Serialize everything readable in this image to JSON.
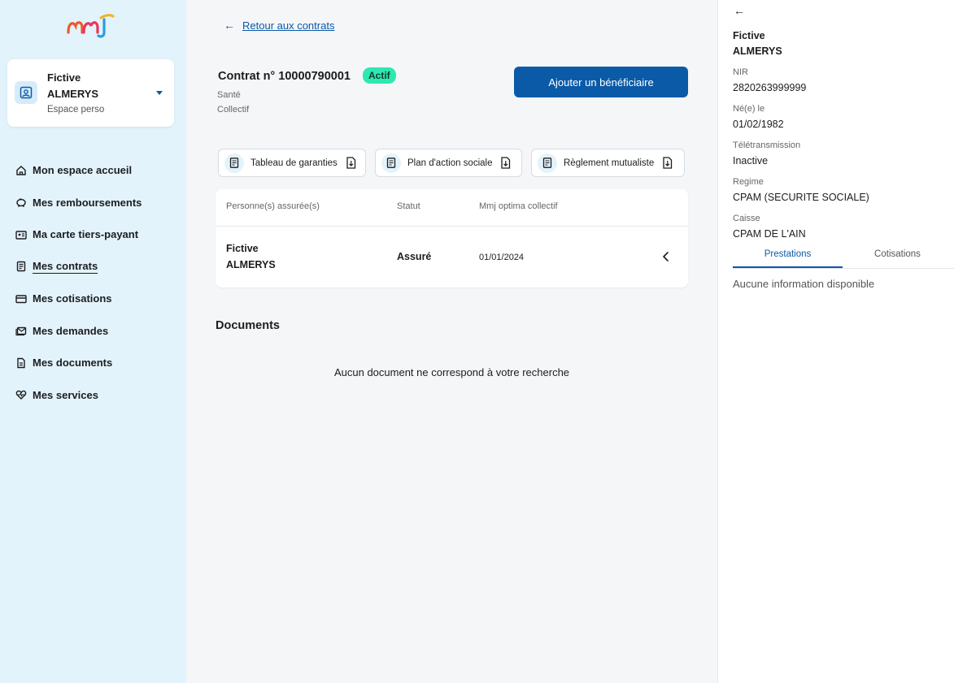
{
  "brand": {
    "logo_text": "mmj"
  },
  "profile": {
    "first_line": "Fictive",
    "second_line": "ALMERYS",
    "sub": "Espace perso"
  },
  "nav": {
    "items": [
      {
        "label": "Mon espace accueil",
        "icon": "home-icon"
      },
      {
        "label": "Mes remboursements",
        "icon": "piggy-bank-icon"
      },
      {
        "label": "Ma carte tiers-payant",
        "icon": "id-card-icon"
      },
      {
        "label": "Mes contrats",
        "icon": "contract-icon",
        "active": true
      },
      {
        "label": "Mes cotisations",
        "icon": "credit-card-icon"
      },
      {
        "label": "Mes demandes",
        "icon": "mail-stack-icon"
      },
      {
        "label": "Mes documents",
        "icon": "document-icon"
      },
      {
        "label": "Mes services",
        "icon": "heart-pulse-icon"
      }
    ]
  },
  "main": {
    "back_label": "Retour aux contrats",
    "contract_title": "Contrat n° 10000790001",
    "status_badge": "Actif",
    "contract_type": "Santé",
    "contract_kind": "Collectif",
    "add_button": "Ajouter un bénéficiaire",
    "doc_chips": [
      {
        "label": "Tableau de garanties"
      },
      {
        "label": "Plan d'action sociale"
      },
      {
        "label": "Règlement mutualiste"
      }
    ],
    "table": {
      "headers": [
        "Personne(s) assurée(s)",
        "Statut",
        "Mmj optima collectif"
      ],
      "rows": [
        {
          "name_first": "Fictive",
          "name_last": "ALMERYS",
          "status": "Assuré",
          "date": "01/01/2024"
        }
      ]
    },
    "documents_title": "Documents",
    "documents_empty": "Aucun document ne correspond à votre recherche"
  },
  "panel": {
    "name_first": "Fictive",
    "name_last": "ALMERYS",
    "fields": [
      {
        "label": "NIR",
        "value": "2820263999999"
      },
      {
        "label": "Né(e) le",
        "value": "01/02/1982"
      },
      {
        "label": "Télétransmission",
        "value": "Inactive"
      },
      {
        "label": "Regime",
        "value": "CPAM (SECURITE SOCIALE)"
      },
      {
        "label": "Caisse",
        "value": "CPAM DE L'AIN"
      }
    ],
    "tabs": [
      {
        "label": "Prestations",
        "active": true
      },
      {
        "label": "Cotisations"
      }
    ],
    "empty": "Aucune information disponible"
  },
  "colors": {
    "primary": "#0a5aa8",
    "badge": "#2ee8b1",
    "sidebar_bg": "#e3f3fc"
  }
}
